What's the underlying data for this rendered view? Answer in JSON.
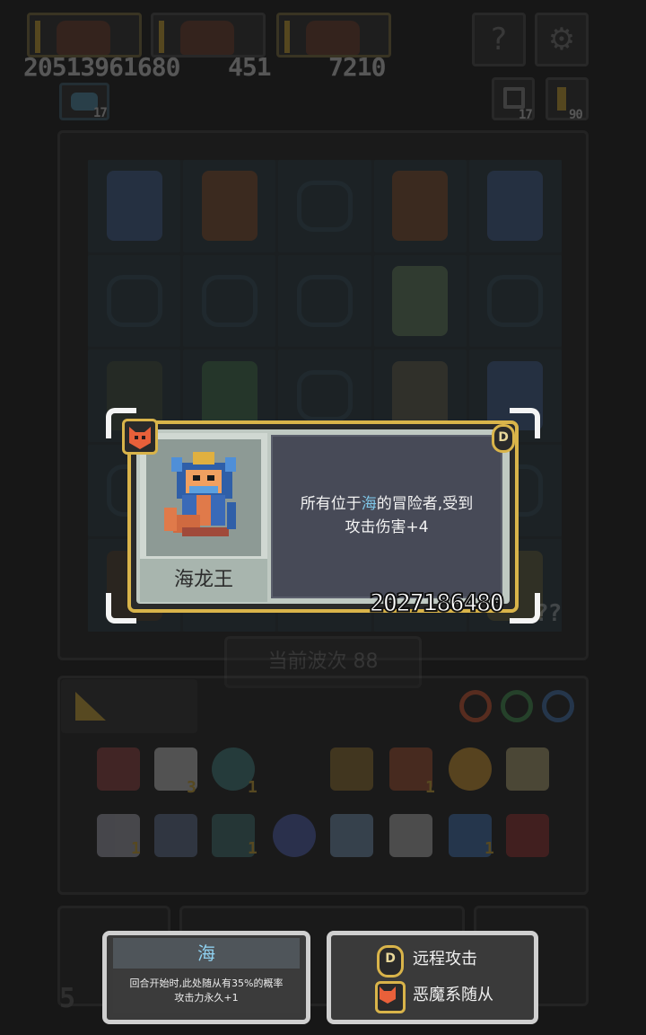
{
  "top_bar": {
    "score_left": "20513961680",
    "score_mid": "451",
    "score_right": "7210",
    "help_icon_label": "?",
    "settings_icon_label": "⚙",
    "left_counter": "17",
    "house_counter": "17",
    "key_counter": "90"
  },
  "board": {
    "wave_label": "当前波次",
    "wave_number": "88",
    "side_counter": "??"
  },
  "inventory": {
    "row1_counts": [
      "3",
      "1",
      "1"
    ],
    "row2_counts": [
      "1",
      "1",
      "1"
    ]
  },
  "tooltip": {
    "unit_name": "海龙王",
    "desc_prefix": "所有位于",
    "desc_highlight": "海",
    "desc_suffix": "的冒险者,受到",
    "desc_line2": "攻击伤害+4",
    "value": "2027186480",
    "range_badge": "D",
    "colors": {
      "frame": "#d9b44a",
      "highlight": "#7fc7e8"
    }
  },
  "bottom": {
    "side_number": "5",
    "sea_panel": {
      "title": "海",
      "desc_line1": "回合开始时,此处随从有35%的概率",
      "desc_line2": "攻击力永久+1"
    },
    "tags": [
      {
        "icon": "range-attack-icon",
        "label": "远程攻击"
      },
      {
        "icon": "demon-fox-icon",
        "label": "恶魔系随从"
      }
    ]
  }
}
